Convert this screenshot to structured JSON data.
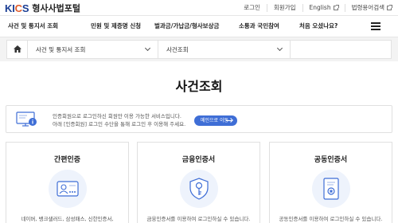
{
  "header": {
    "logo": "KICS",
    "site_title": "형사사법포털",
    "util_links": [
      {
        "label": "로그인",
        "external": false
      },
      {
        "label": "회원가입",
        "external": false
      },
      {
        "label": "English",
        "external": true
      },
      {
        "label": "법령용어검색",
        "external": true
      }
    ]
  },
  "nav": {
    "items": [
      "사건 및 통지서 조회",
      "민원 및 제증명 신청",
      "벌과금/가납금/형사보상금",
      "소통과 국민참여",
      "처음 오셨나요?"
    ]
  },
  "breadcrumb": {
    "level1": "사건 및 통지서 조회",
    "level2": "사건조회"
  },
  "page": {
    "title": "사건조회"
  },
  "notice": {
    "line1": "인증회원으로 로그인하신 회원만 이용 가능한 서비스입니다.",
    "line2": "아래 [인증회원] 로그인 수단을 통해 로그인 후 이용해 주세요.",
    "button_label": "메인으로 이동"
  },
  "login_options": [
    {
      "title": "간편인증",
      "icon": "simple-auth-icon",
      "desc": "네이버, 뱅크샐러드, 삼성패스, 신한인증서,"
    },
    {
      "title": "금융인증서",
      "icon": "financial-cert-icon",
      "desc": "금융인증서를 이용하여 로그인하실 수 있습니다."
    },
    {
      "title": "공동인증서",
      "icon": "joint-cert-icon",
      "desc": "공동인증서를 이용하여 로그인하실 수 있습니다."
    }
  ],
  "colors": {
    "brand_blue": "#1c3f94",
    "brand_accent": "#e05b2a",
    "button_blue": "#3f6ed6",
    "icon_bg": "#eef3fc"
  }
}
